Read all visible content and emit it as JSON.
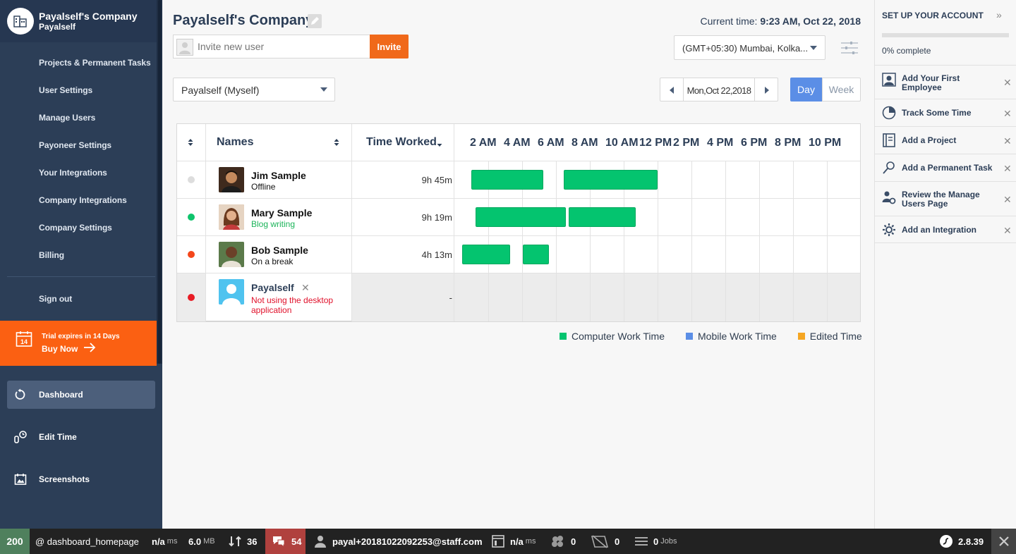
{
  "sidebar": {
    "company_name": "Payalself's Company",
    "company_user": "Payalself",
    "menu": [
      "Projects & Permanent Tasks",
      "User Settings",
      "Manage Users",
      "Payoneer Settings",
      "Your Integrations",
      "Company Integrations",
      "Company Settings",
      "Billing"
    ],
    "sign_out": "Sign out",
    "trial": {
      "day": "14",
      "text": "Trial expires in 14 Days",
      "cta": "Buy Now"
    },
    "nav": [
      {
        "label": "Dashboard",
        "icon": "dashboard-icon",
        "active": true
      },
      {
        "label": "Edit Time",
        "icon": "edit-time-icon",
        "active": false
      },
      {
        "label": "Screenshots",
        "icon": "screenshots-icon",
        "active": false
      }
    ]
  },
  "header": {
    "title": "Payalself's Company",
    "time_label": "Current time: ",
    "time_value": "9:23 AM, Oct 22, 2018",
    "invite_placeholder": "Invite new user",
    "invite_button": "Invite",
    "timezone": "(GMT+05:30) Mumbai, Kolka...",
    "user_filter": "Payalself (Myself)",
    "date": "Mon,Oct 22,2018",
    "view_day": "Day",
    "view_week": "Week"
  },
  "table": {
    "col_names": "Names",
    "col_time": "Time Worked",
    "hours": [
      "2 AM",
      "4 AM",
      "6 AM",
      "8 AM",
      "10 AM",
      "12 PM",
      "2 PM",
      "4 PM",
      "6 PM",
      "8 PM",
      "10 PM"
    ],
    "rows": [
      {
        "name": "Jim Sample",
        "status": "Offline",
        "status_color": "#111111",
        "dot_color": "#dddddd",
        "time": "9h 45m",
        "bars": [
          [
            0.5,
            4.75
          ],
          [
            5.95,
            11.5
          ]
        ]
      },
      {
        "name": "Mary Sample",
        "status": "Blog writing",
        "status_color": "#1cb45a",
        "dot_color": "#0fc46c",
        "time": "9h 19m",
        "bars": [
          [
            0.75,
            6.1
          ],
          [
            6.25,
            10.2
          ]
        ]
      },
      {
        "name": "Bob Sample",
        "status": "On a break",
        "status_color": "#111111",
        "dot_color": "#f4471b",
        "time": "4h 13m",
        "bars": [
          [
            -0.05,
            2.8
          ],
          [
            3.55,
            5.1
          ]
        ]
      },
      {
        "name": "Payalself",
        "status": "Not using the desktop application",
        "status_color": "#e0102a",
        "dot_color": "#e81c25",
        "time": "-",
        "bars": []
      }
    ]
  },
  "legend": [
    {
      "label": "Computer Work Time",
      "color": "#04c46f"
    },
    {
      "label": "Mobile Work Time",
      "color": "#5b8ee6"
    },
    {
      "label": "Edited Time",
      "color": "#f5a623"
    }
  ],
  "setup": {
    "title": "SET UP YOUR ACCOUNT",
    "progress": 0,
    "progress_text": "0% complete",
    "tasks": [
      {
        "label": "Add Your First Employee",
        "icon": "user-icon"
      },
      {
        "label": "Track Some Time",
        "icon": "pie-clock-icon"
      },
      {
        "label": "Add a Project",
        "icon": "notebook-icon"
      },
      {
        "label": "Add a Permanent Task",
        "icon": "pin-icon"
      },
      {
        "label": "Review the Manage Users Page",
        "icon": "users-gear-icon"
      },
      {
        "label": "Add an Integration",
        "icon": "gear-icon"
      }
    ]
  },
  "toolbar": {
    "status": "200",
    "route": "@ dashboard_homepage",
    "time": "n/a",
    "time_unit": "ms",
    "memory": "6.0",
    "memory_unit": "MB",
    "requests": "36",
    "errors": "54",
    "user": "payal+20181022092253@staff.com",
    "render": "n/a",
    "render_unit": "ms",
    "cache": "0",
    "security": "0",
    "jobs": "0",
    "jobs_label": "Jobs",
    "version": "2.8.39"
  }
}
